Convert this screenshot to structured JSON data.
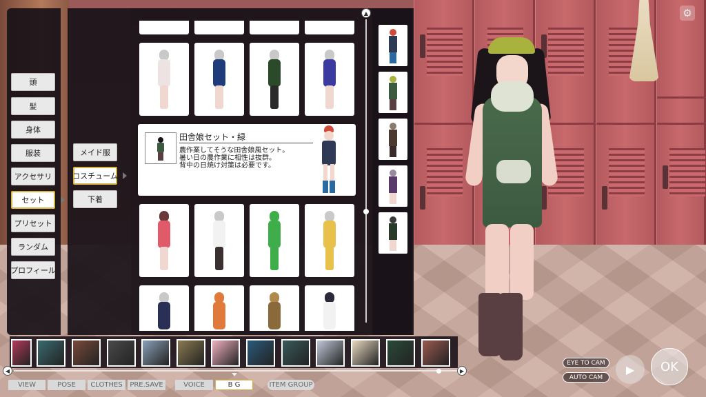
{
  "categories": {
    "items": [
      "頭",
      "髪",
      "身体",
      "服装",
      "アクセサリ",
      "セット",
      "プリセット",
      "ランダム",
      "プロフィール"
    ],
    "selected": "セット"
  },
  "subcategories": {
    "items": [
      "メイド服",
      "コスチューム",
      "下着"
    ],
    "selected": "コスチューム"
  },
  "tooltip": {
    "title": "田舎娘セット・緑",
    "lines": [
      "農作業してそうな田舎娘風セット。",
      "暑い日の農作業に相性は抜群。",
      "背中の日焼け対策は必要です。"
    ]
  },
  "outfit_grid": {
    "card_colors": [
      [
        "#ede3e3",
        "#1f3c7a",
        "#2a4a2a",
        "#3a3aa0"
      ],
      [
        "#e05a6a",
        "#f2f2f2",
        "#3fae4a",
        "#e8c14a"
      ],
      [
        "#2a2f55",
        "#e07a3a",
        "#8a6a3a",
        "#f2f2f2"
      ]
    ]
  },
  "bottom_tabs": {
    "items": [
      "VIEW",
      "POSE",
      "CLOTHES",
      "PRE.SAVE",
      "VOICE",
      "B G",
      "ITEM GROUP"
    ],
    "selected": "B G"
  },
  "bg_thumbs": {
    "colors": [
      "#b03a5a",
      "#3a6a70",
      "#7a4a3a",
      "#4a4a4a",
      "#8aa0b8",
      "#8a7a50",
      "#f0b0c0",
      "#2a5a7a",
      "#3a5a5a",
      "#c0c8d8",
      "#e8d8c0",
      "#2a4a3a",
      "#9a5a50"
    ]
  },
  "controls": {
    "eye_to_cam": "EYE TO CAM",
    "auto_cam": "AUTO CAM",
    "ok": "OK",
    "settings_icon": "gear-icon",
    "camera_icon": "camera-icon"
  }
}
